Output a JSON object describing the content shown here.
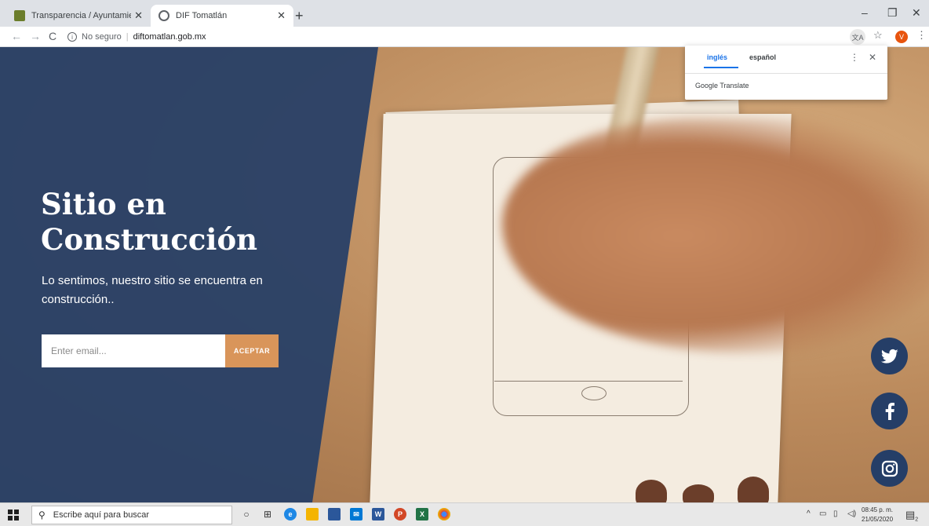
{
  "browser": {
    "tabs": [
      {
        "title": "Transparencia / Ayuntamiento de",
        "active": false
      },
      {
        "title": "DIF Tomatlán",
        "active": true
      }
    ],
    "security_label": "No seguro",
    "url": "diftomatlan.gob.mx",
    "profile_initial": "V"
  },
  "translate_popup": {
    "tabs": [
      "inglés",
      "español"
    ],
    "brand": "Google Translate"
  },
  "hero": {
    "title_line1": "Sitio en",
    "title_line2": "Construcción",
    "subtitle": "Lo sentimos, nuestro sitio se encuentra en construcción..",
    "email_placeholder": "Enter email...",
    "submit_label": "ACEPTAR"
  },
  "social": [
    "twitter-icon",
    "facebook-icon",
    "instagram-icon"
  ],
  "taskbar": {
    "search_placeholder": "Escribe aquí para buscar",
    "time": "08:45 p. m.",
    "date": "21/05/2020",
    "notification_count": "2"
  },
  "colors": {
    "overlay": "#253e67",
    "accent": "#d9955a"
  }
}
